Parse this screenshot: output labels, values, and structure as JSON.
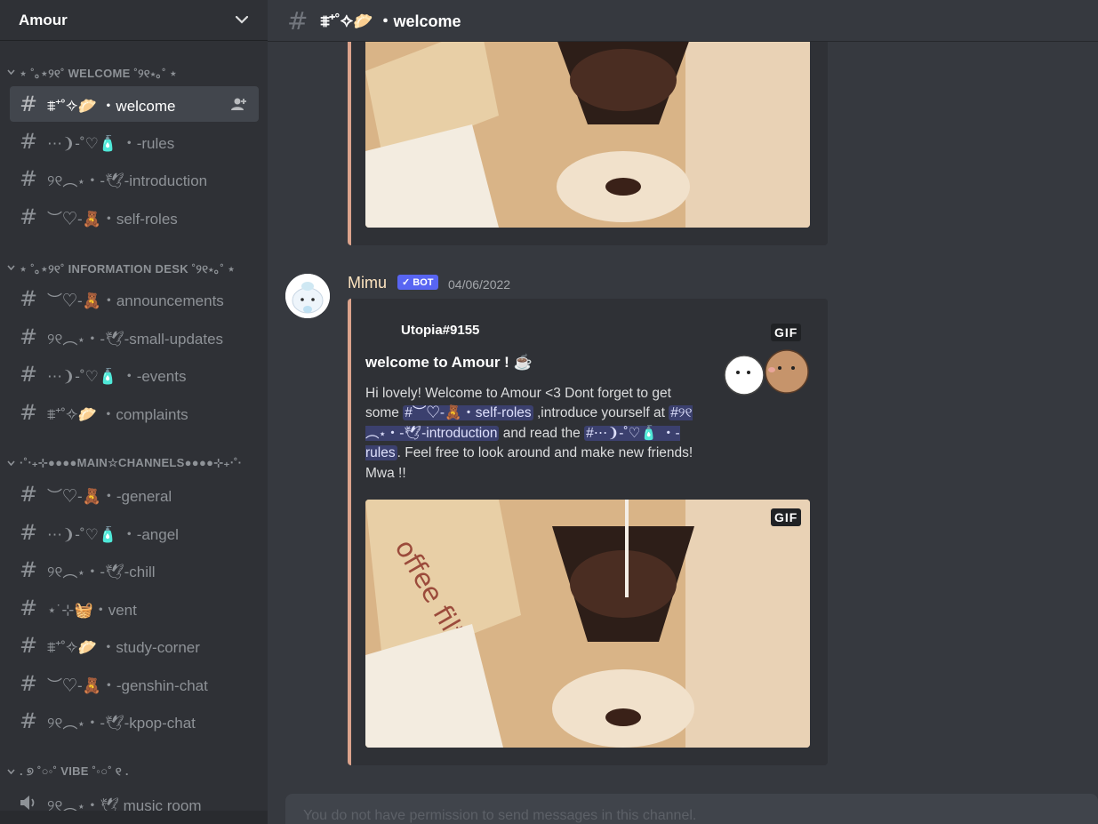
{
  "server": {
    "name": "Amour"
  },
  "categories": [
    {
      "label": "⋆ ˚｡⋆୨୧˚ WELCOME ˚୨୧⋆｡˚ ⋆"
    },
    {
      "label": "⋆ ˚｡⋆୨୧˚ INFORMATION DESK ˚୨୧⋆｡˚ ⋆"
    },
    {
      "label": "·˚‧₊⊹●●●●MAIN☆CHANNELS●●●●⊹₊‧˚·"
    },
    {
      "label": ". ୭ ˚○◦˚ VIBE ˚◦○˚ ୧ ."
    }
  ],
  "channels": [
    {
      "label": "⩨⁺˚✧🥟 ・welcome",
      "active": true
    },
    {
      "label": "⋯❩-˚♡🧴 ・-rules"
    },
    {
      "label": "୨୧︵⋆・-🕊-introduction"
    },
    {
      "label": "︶♡-🧸・self-roles"
    },
    {
      "label": "︶♡-🧸・announcements"
    },
    {
      "label": "୨୧︵⋆・-🕊-small-updates"
    },
    {
      "label": "⋯❩-˚♡🧴 ・-events"
    },
    {
      "label": "⩨⁺˚✧🥟 ・complaints"
    },
    {
      "label": "︶♡-🧸・-general"
    },
    {
      "label": "⋯❩-˚♡🧴 ・-angel"
    },
    {
      "label": "୨୧︵⋆・-🕊-chill"
    },
    {
      "label": "⋆˙⊹🧺・vent"
    },
    {
      "label": "⩨⁺˚✧🥟 ・study-corner"
    },
    {
      "label": "︶♡-🧸・-genshin-chat"
    },
    {
      "label": "୨୧︵⋆・-🕊-kpop-chat"
    },
    {
      "label": "୨୧︵⋆・🕊 music room"
    }
  ],
  "topbar": {
    "title": "⩨⁺˚✧🥟 ・welcome"
  },
  "message": {
    "author": "Mimu",
    "bot_badge": "✓ BOT",
    "timestamp": "04/06/2022",
    "embed": {
      "author": "Utopia#9155",
      "title": "welcome to Amour ! ☕",
      "desc_1": "Hi lovely! Welcome to Amour <3 Dont forget to get some ",
      "mention_1": "#︶♡-🧸・self-roles",
      "desc_2": " ,introduce yourself at ",
      "mention_2": "#୨୧︵⋆・-🕊-introduction",
      "desc_3": " and read the ",
      "mention_3": "#⋯❩-˚♡🧴 ・-rules",
      "desc_4": ". Feel free to look around and make new friends! Mwa !!",
      "gif_badge": "GIF"
    }
  },
  "composer": {
    "placeholder": "You do not have permission to send messages in this channel."
  },
  "colors": {
    "accent": "#5865f2",
    "embed_border": "#dca38c",
    "sidebar_bg": "#2f3136",
    "main_bg": "#36393f"
  }
}
